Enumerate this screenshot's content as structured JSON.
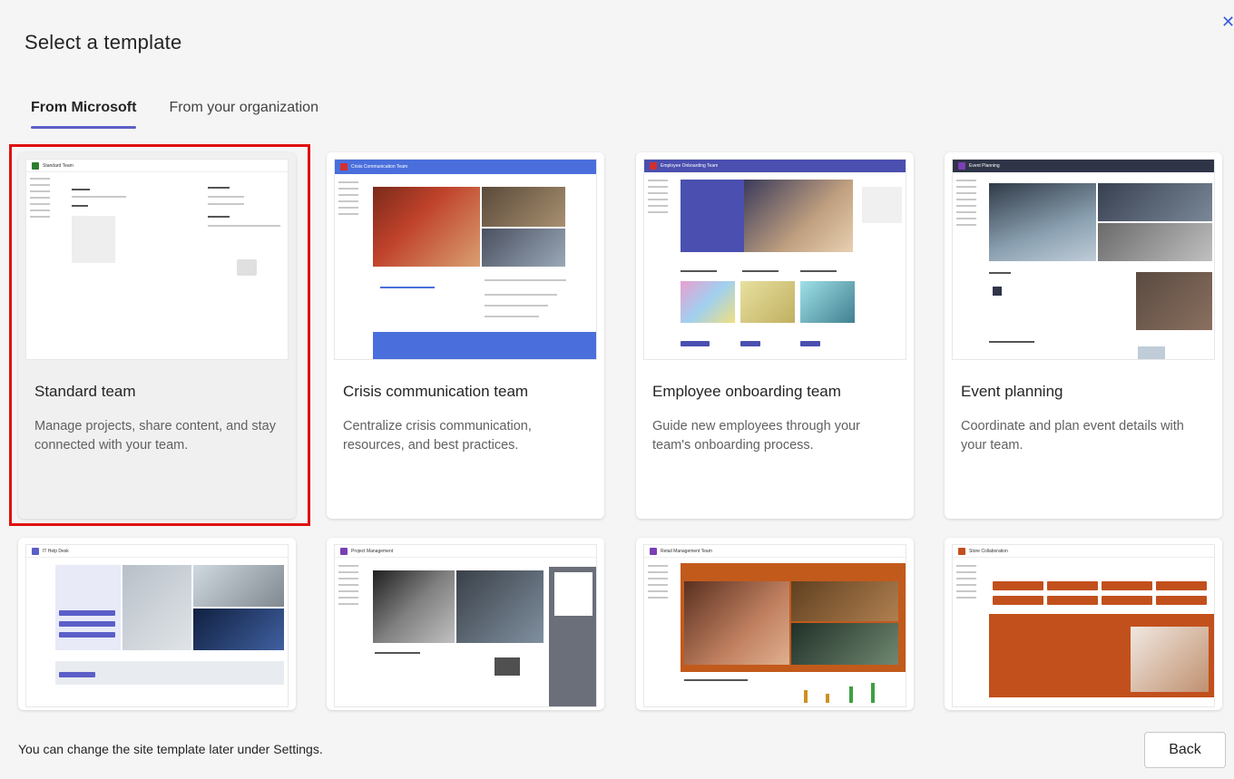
{
  "dialog": {
    "title": "Select a template",
    "close_icon": "close-icon"
  },
  "tabs": [
    {
      "label": "From Microsoft",
      "active": true
    },
    {
      "label": "From your organization",
      "active": false
    }
  ],
  "templates": [
    {
      "name": "Standard team",
      "description": "Manage projects, share content, and stay connected with your team.",
      "selected": true,
      "accent": "#2e7d32"
    },
    {
      "name": "Crisis communication team",
      "description": "Centralize crisis communication, resources, and best practices.",
      "selected": false,
      "accent": "#4a6fdc"
    },
    {
      "name": "Employee onboarding team",
      "description": "Guide new employees through your team's onboarding process.",
      "selected": false,
      "accent": "#4a4fb0"
    },
    {
      "name": "Event planning",
      "description": "Coordinate and plan event details with your team.",
      "selected": false,
      "accent": "#2f3447"
    },
    {
      "name": "IT help desk",
      "description": "",
      "selected": false,
      "accent": "#5b5fc7"
    },
    {
      "name": "Project management",
      "description": "",
      "selected": false,
      "accent": "#7b3fb5"
    },
    {
      "name": "Retail management team",
      "description": "",
      "selected": false,
      "accent": "#c25a1c"
    },
    {
      "name": "Store collaboration",
      "description": "",
      "selected": false,
      "accent": "#c2501c"
    }
  ],
  "footer": {
    "note": "You can change the site template later under Settings.",
    "back_label": "Back"
  },
  "colors": {
    "selection_outline": "#e01010",
    "tab_indicator": "#5b5fc7"
  }
}
